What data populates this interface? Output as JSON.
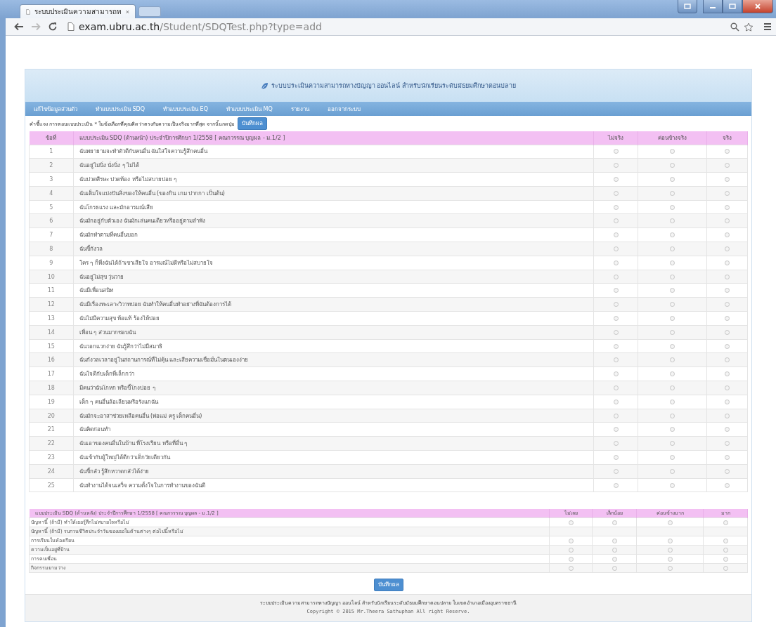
{
  "browser": {
    "tab_title": "ระบบประเมินความสามารถท",
    "url_host": "exam.ubru.ac.th",
    "url_path": "/Student/SDQTest.php?type=add"
  },
  "header": {
    "title": "ระบบประเมินความสามารถทางปัญญา ออนไลน์ สำหรับนักเรียนระดับมัธยมศึกษาตอนปลาย"
  },
  "nav": [
    "แก้ไขข้อมูลส่วนตัว",
    "ทำแบบประเมิน SDQ",
    "ทำแบบประเมิน EQ",
    "ทำแบบประเมิน MQ",
    "รายงาน",
    "ออกจากระบบ"
  ],
  "instruction": {
    "text": "คำชี้แจง การตอบแบบประเมิน * ในข้อเลือกที่คุณคิดว่าตรงกับความเป็นจริงมากที่สุด จากนั้นกดปุ่ม",
    "button": "บันทึกผล"
  },
  "front_table": {
    "columns": [
      "ข้อที่",
      "แบบประเมิน SDQ (ด้านหน้า) ประจำปีการศึกษา 1/2558 [ คณกวรรณ บุญผล - ม.1/2 ]",
      "ไม่จริง",
      "ค่อนข้างจริง",
      "จริง"
    ],
    "rows": [
      {
        "number": "1",
        "text": "ฉันพยายามจะทำตัวดีกับคนอื่น ฉันใส่ใจความรู้สึกคนอื่น",
        "choices": [
          {
            "selected": false
          },
          {
            "selected": false
          },
          {
            "selected": false
          }
        ]
      },
      {
        "number": "2",
        "text": "ฉันอยู่ไม่นิ่ง นั่งนิ่ง ๆ ไม่ได้",
        "choices": [
          {
            "selected": false
          },
          {
            "selected": false
          },
          {
            "selected": false
          }
        ]
      },
      {
        "number": "3",
        "text": "ฉันปวดศีรษะ ปวดท้อง หรือไม่สบายบ่อย ๆ",
        "choices": [
          {
            "selected": false
          },
          {
            "selected": false
          },
          {
            "selected": false
          }
        ]
      },
      {
        "number": "4",
        "text": "ฉันเต็มใจแบ่งปันสิ่งของให้คนอื่น (ของกิน เกม ปากกา เป็นต้น)",
        "choices": [
          {
            "selected": false
          },
          {
            "selected": false
          },
          {
            "selected": false
          }
        ]
      },
      {
        "number": "5",
        "text": "ฉันโกรธแรง และมักอารมณ์เสีย",
        "choices": [
          {
            "selected": false
          },
          {
            "selected": false
          },
          {
            "selected": false
          }
        ]
      },
      {
        "number": "6",
        "text": "ฉันมักอยู่กับตัวเอง ฉันมักเล่นคนเดียวหรืออยู่ตามลำพัง",
        "choices": [
          {
            "selected": false
          },
          {
            "selected": false
          },
          {
            "selected": false
          }
        ]
      },
      {
        "number": "7",
        "text": "ฉันมักทำตามที่คนอื่นบอก",
        "choices": [
          {
            "selected": false
          },
          {
            "selected": false
          },
          {
            "selected": false
          }
        ]
      },
      {
        "number": "8",
        "text": "ฉันขี้กังวล",
        "choices": [
          {
            "selected": false
          },
          {
            "selected": false
          },
          {
            "selected": false
          }
        ]
      },
      {
        "number": "9",
        "text": "ใคร ๆ ก็พึ่งฉันได้ถ้าเขาเสียใจ อารมณ์ไม่ดีหรือไม่สบายใจ",
        "choices": [
          {
            "selected": false
          },
          {
            "selected": false
          },
          {
            "selected": false
          }
        ]
      },
      {
        "number": "10",
        "text": "ฉันอยู่ไม่สุข วุ่นวาย",
        "choices": [
          {
            "selected": false
          },
          {
            "selected": false
          },
          {
            "selected": false
          }
        ]
      },
      {
        "number": "11",
        "text": "ฉันมีเพื่อนสนิท",
        "choices": [
          {
            "selected": false
          },
          {
            "selected": false
          },
          {
            "selected": false
          }
        ]
      },
      {
        "number": "12",
        "text": "ฉันมีเรื่องทะเลาะวิวาทบ่อย ฉันทำให้คนอื่นทำอย่างที่ฉันต้องการได้",
        "choices": [
          {
            "selected": false
          },
          {
            "selected": false
          },
          {
            "selected": false
          }
        ]
      },
      {
        "number": "13",
        "text": "ฉันไม่มีความสุข ท้อแท้ ร้องไห้บ่อย",
        "choices": [
          {
            "selected": false
          },
          {
            "selected": false
          },
          {
            "selected": false
          }
        ]
      },
      {
        "number": "14",
        "text": "เพื่อน ๆ ส่วนมากชอบฉัน",
        "choices": [
          {
            "selected": false
          },
          {
            "selected": false
          },
          {
            "selected": false
          }
        ]
      },
      {
        "number": "15",
        "text": "ฉันวอกแวกง่าย ฉันรู้สึกว่าไม่มีสมาธิ",
        "choices": [
          {
            "selected": false
          },
          {
            "selected": false
          },
          {
            "selected": false
          }
        ]
      },
      {
        "number": "16",
        "text": "ฉันกังวลเวลาอยู่ในสถานการณ์ที่ไม่คุ้น และเสียความเชื่อมั่นในตนเองง่าย",
        "choices": [
          {
            "selected": false
          },
          {
            "selected": false
          },
          {
            "selected": false
          }
        ]
      },
      {
        "number": "17",
        "text": "ฉันใจดีกับเด็กที่เล็กกว่า",
        "choices": [
          {
            "selected": false
          },
          {
            "selected": false
          },
          {
            "selected": false
          }
        ]
      },
      {
        "number": "18",
        "text": "มีคนว่าฉันโกหก หรือขี้โกงบ่อย ๆ",
        "choices": [
          {
            "selected": false
          },
          {
            "selected": false
          },
          {
            "selected": false
          }
        ]
      },
      {
        "number": "19",
        "text": "เด็ก ๆ คนอื่นล้อเลียนหรือรังแกฉัน",
        "choices": [
          {
            "selected": false
          },
          {
            "selected": false
          },
          {
            "selected": false
          }
        ]
      },
      {
        "number": "20",
        "text": "ฉันมักจะอาสาช่วยเหลือคนอื่น (พ่อแม่ ครู เด็กคนอื่น)",
        "choices": [
          {
            "selected": false
          },
          {
            "selected": false
          },
          {
            "selected": false
          }
        ]
      },
      {
        "number": "21",
        "text": "ฉันคิดก่อนทำ",
        "choices": [
          {
            "selected": false
          },
          {
            "selected": false
          },
          {
            "selected": false
          }
        ]
      },
      {
        "number": "22",
        "text": "ฉันเอาของคนอื่นในบ้าน ที่โรงเรียน หรือที่อื่น ๆ",
        "choices": [
          {
            "selected": false
          },
          {
            "selected": false
          },
          {
            "selected": false
          }
        ]
      },
      {
        "number": "23",
        "text": "ฉันเข้ากับผู้ใหญ่ได้ดีกว่าเด็กวัยเดียวกัน",
        "choices": [
          {
            "selected": false
          },
          {
            "selected": false
          },
          {
            "selected": false
          }
        ]
      },
      {
        "number": "24",
        "text": "ฉันขี้กลัว รู้สึกหวาดกลัวได้ง่าย",
        "choices": [
          {
            "selected": false
          },
          {
            "selected": false
          },
          {
            "selected": false
          }
        ]
      },
      {
        "number": "25",
        "text": "ฉันทำงานได้จนเสร็จ ความตั้งใจในการทำงานของฉันดี",
        "choices": [
          {
            "selected": false
          },
          {
            "selected": false
          },
          {
            "selected": false
          }
        ]
      }
    ]
  },
  "back_table": {
    "columns": [
      "แบบประเมิน SDQ (ด้านหลัง) ประจำปีการศึกษา 1/2558 [ คณกวรรณ บุญผล - ม.1/2 ]",
      "ไม่เลย",
      "เล็กน้อย",
      "ค่อนข้างมาก",
      "มาก"
    ],
    "rows": [
      {
        "text": "ปัญหานี้ (ถ้ามี) ทำให้เธอรู้สึกไม่สบายใจหรือไม่",
        "choices": [
          {
            "selected": false
          },
          {
            "selected": false
          },
          {
            "selected": false
          },
          {
            "selected": false
          }
        ]
      },
      {
        "text": "ปัญหานี้ (ถ้ามี) รบกวนชีวิตประจำวันของเธอในด้านต่างๆ ต่อไปนี้หรือไม่"
      },
      {
        "text": "การเรียนในห้องเรียน",
        "choices": [
          {
            "selected": false
          },
          {
            "selected": false
          },
          {
            "selected": false
          },
          {
            "selected": false
          }
        ]
      },
      {
        "text": "ความเป็นอยู่ที่บ้าน",
        "choices": [
          {
            "selected": false
          },
          {
            "selected": false
          },
          {
            "selected": false
          },
          {
            "selected": false
          }
        ]
      },
      {
        "text": "การคบเพื่อน",
        "choices": [
          {
            "selected": false
          },
          {
            "selected": false
          },
          {
            "selected": false
          },
          {
            "selected": false
          }
        ]
      },
      {
        "text": "กิจกรรมยามว่าง",
        "choices": [
          {
            "selected": false
          },
          {
            "selected": false
          },
          {
            "selected": false
          },
          {
            "selected": false
          }
        ]
      }
    ]
  },
  "save_button": "บันทึกผล",
  "footer": {
    "line": "ระบบประเมินความสามารถทางปัญญา ออนไลน์ สำหรับนักเรียนระดับมัธยมศึกษาตอนปลาย ในเขตอำเภอเมืองอุบลราชธานี",
    "copyright": "Copyright © 2015 Mr.Theera Sathuphan  All right Reserve."
  }
}
